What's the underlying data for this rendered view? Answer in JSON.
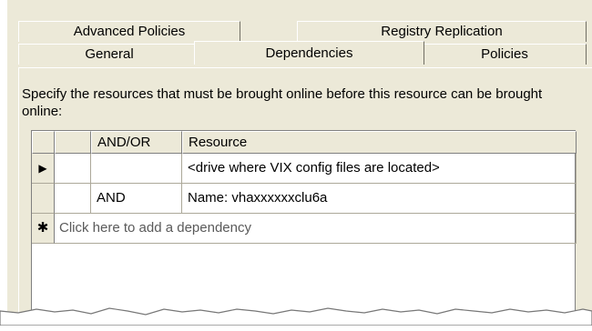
{
  "tabs_back": [
    "Advanced Policies",
    "Registry Replication"
  ],
  "tabs_front": [
    "General",
    "Dependencies",
    "Policies"
  ],
  "description": "Specify the resources that must be brought online before this resource can be brought online:",
  "grid": {
    "columns": [
      "AND/OR",
      "Resource"
    ],
    "rows": [
      {
        "indicator": "▶",
        "andor": "",
        "resource": "<drive where VIX config files are located>"
      },
      {
        "indicator": "",
        "andor": "AND",
        "resource": "Name: vhaxxxxxxclu6a"
      }
    ],
    "new_row_indicator": "✱",
    "new_row_placeholder": "Click here to add a dependency"
  }
}
